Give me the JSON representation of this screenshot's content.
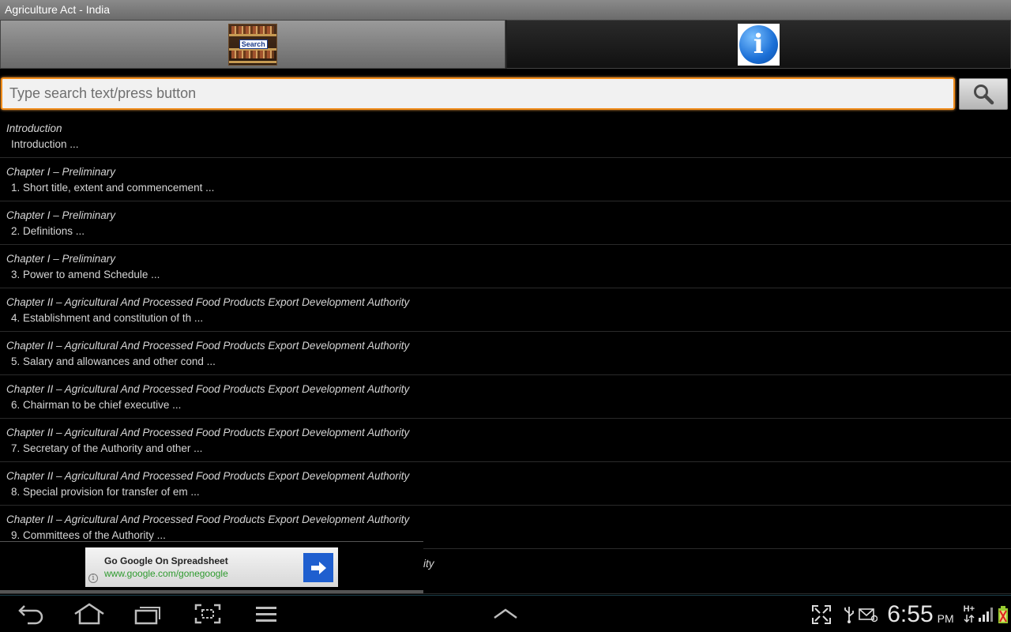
{
  "app": {
    "title": "Agriculture Act - India"
  },
  "tabs": {
    "search": {
      "icon": "search-books-icon",
      "label": "Search"
    },
    "info": {
      "icon": "info-icon",
      "glyph": "i"
    }
  },
  "search": {
    "placeholder": "Type search text/press button",
    "value": "",
    "button_icon": "magnifier-icon"
  },
  "items": [
    {
      "chapter": "Introduction",
      "section": "Introduction ..."
    },
    {
      "chapter": "Chapter I –  Preliminary",
      "section": "1. Short title, extent and commencement ..."
    },
    {
      "chapter": "Chapter I –  Preliminary",
      "section": "2. Definitions ..."
    },
    {
      "chapter": "Chapter I –  Preliminary",
      "section": "3. Power to amend Schedule ..."
    },
    {
      "chapter": "Chapter II – Agricultural And Processed Food Products Export Development Authority",
      "section": "4. Establishment and constitution of th ..."
    },
    {
      "chapter": "Chapter II – Agricultural And Processed Food Products Export Development Authority",
      "section": "5. Salary and allowances and other cond ..."
    },
    {
      "chapter": "Chapter II – Agricultural And Processed Food Products Export Development Authority",
      "section": "6. Chairman to be chief executive ..."
    },
    {
      "chapter": "Chapter II – Agricultural And Processed Food Products Export Development Authority",
      "section": "7. Secretary of the Authority and other ..."
    },
    {
      "chapter": "Chapter II – Agricultural And Processed Food Products Export Development Authority",
      "section": "8. Special provision for transfer of em ..."
    },
    {
      "chapter": "Chapter II – Agricultural And Processed Food Products Export Development Authority",
      "section": "9. Committees of the Authority ..."
    }
  ],
  "partial_item": {
    "visible_tail": "ity"
  },
  "ad": {
    "title": "Go Google On Spreadsheet",
    "url": "www.google.com/gonegoogle",
    "info_glyph": "i",
    "arrow_icon": "arrow-right-icon"
  },
  "navbar": {
    "buttons": [
      "back-icon",
      "home-icon",
      "recent-apps-icon",
      "screenshot-icon",
      "menu-icon"
    ],
    "center": "chevron-up-icon"
  },
  "status": {
    "time": "6:55",
    "ampm": "PM",
    "network": "H+",
    "icons": [
      "fullscreen-icon",
      "usb-icon",
      "email-icon",
      "network-type-icon",
      "signal-icon",
      "battery-icon"
    ]
  },
  "colors": {
    "accent": "#f08c1a",
    "ad_url": "#2e9a2e",
    "ad_arrow": "#1f5fcf",
    "info_blue": "#1b6fd6"
  }
}
